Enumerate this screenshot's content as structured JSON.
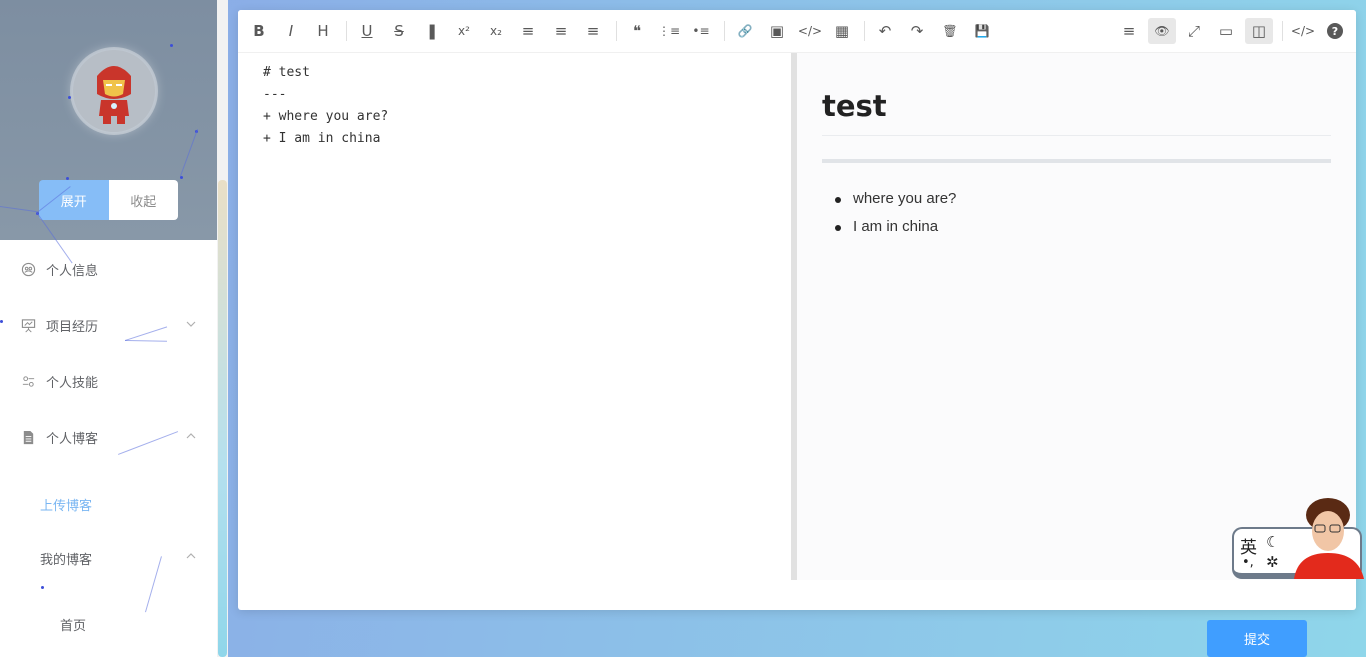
{
  "sidebar": {
    "toggle": {
      "expand": "展开",
      "collapse": "收起"
    },
    "menu": [
      {
        "label": "个人信息",
        "icon": "user-circle-icon"
      },
      {
        "label": "项目经历",
        "icon": "presentation-icon"
      },
      {
        "label": "个人技能",
        "icon": "skills-icon"
      },
      {
        "label": "个人博客",
        "icon": "document-icon"
      }
    ],
    "submenu": [
      {
        "label": "上传博客",
        "active": true
      },
      {
        "label": "我的博客",
        "active": false
      }
    ],
    "home": "首页"
  },
  "editor": {
    "toolbar_left": [
      {
        "icon": "bold-icon",
        "glyph": "B"
      },
      {
        "icon": "italic-icon",
        "glyph": "I"
      },
      {
        "icon": "heading-icon",
        "glyph": "H"
      },
      {
        "icon": "underline-icon",
        "glyph": "U"
      },
      {
        "icon": "strikethrough-icon",
        "glyph": "S"
      },
      {
        "icon": "bookmark-icon",
        "glyph": "❚"
      },
      {
        "icon": "superscript-icon",
        "glyph": "x²"
      },
      {
        "icon": "subscript-icon",
        "glyph": "x₂"
      },
      {
        "icon": "align-left-icon",
        "glyph": "≡"
      },
      {
        "icon": "align-center-icon",
        "glyph": "≡"
      },
      {
        "icon": "align-right-icon",
        "glyph": "≡"
      },
      {
        "icon": "quote-icon",
        "glyph": "❝"
      },
      {
        "icon": "ordered-list-icon",
        "glyph": "⋮≡"
      },
      {
        "icon": "unordered-list-icon",
        "glyph": "•≡"
      },
      {
        "icon": "link-icon",
        "glyph": "🔗"
      },
      {
        "icon": "image-icon",
        "glyph": "▣"
      },
      {
        "icon": "code-icon",
        "glyph": "</>"
      },
      {
        "icon": "table-icon",
        "glyph": "▦"
      },
      {
        "icon": "undo-icon",
        "glyph": "↶"
      },
      {
        "icon": "redo-icon",
        "glyph": "↷"
      },
      {
        "icon": "trash-icon",
        "glyph": "🗑"
      },
      {
        "icon": "save-icon",
        "glyph": "💾"
      }
    ],
    "toolbar_right": [
      {
        "icon": "navigation-icon",
        "glyph": "≡",
        "active": false
      },
      {
        "icon": "preview-toggle-icon",
        "glyph": "👁",
        "active": true
      },
      {
        "icon": "fullscreen-icon",
        "glyph": "⤢",
        "active": false
      },
      {
        "icon": "window-icon",
        "glyph": "▭",
        "active": false
      },
      {
        "icon": "split-view-icon",
        "glyph": "◫",
        "active": true
      },
      {
        "icon": "html-code-icon",
        "glyph": "</>",
        "active": false
      },
      {
        "icon": "help-icon",
        "glyph": "?",
        "active": false
      }
    ],
    "source_lines": [
      "# test",
      "---",
      "+ where you are?",
      "+ I am in china"
    ],
    "preview": {
      "title": "test",
      "items": [
        "where you are?",
        "I am in china"
      ]
    }
  },
  "submit_label": "提交",
  "ime": {
    "lang": "英",
    "punct": "•,",
    "moon": "☾",
    "butterfly": "✲"
  }
}
